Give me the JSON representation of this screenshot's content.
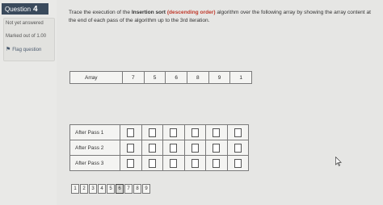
{
  "question": {
    "prefix": "Question",
    "number": "4",
    "status": "Not yet answered",
    "marks": "Marked out of 1.00",
    "flag_label": "Flag question",
    "flag_icon": "flag-icon"
  },
  "prompt": {
    "part1": "Trace the execution of the ",
    "bold": "Insertion sort",
    "part2": " ",
    "red": "(descending order)",
    "part3": " algorithm over the following array by showing the array content at the end of each pass of the algorithm up to the 3rd iteration."
  },
  "array": {
    "label": "Array",
    "values": [
      "7",
      "5",
      "6",
      "8",
      "9",
      "1"
    ]
  },
  "passes": [
    {
      "label": "After Pass 1",
      "inputs": [
        "",
        "",
        "",
        "",
        "",
        ""
      ]
    },
    {
      "label": "After Pass 2",
      "inputs": [
        "",
        "",
        "",
        "",
        "",
        ""
      ]
    },
    {
      "label": "After Pass 3",
      "inputs": [
        "",
        "",
        "",
        "",
        "",
        ""
      ]
    }
  ],
  "pager": [
    "1",
    "2",
    "3",
    "4",
    "5",
    "6",
    "7",
    "8",
    "9"
  ],
  "pager_active": "6"
}
